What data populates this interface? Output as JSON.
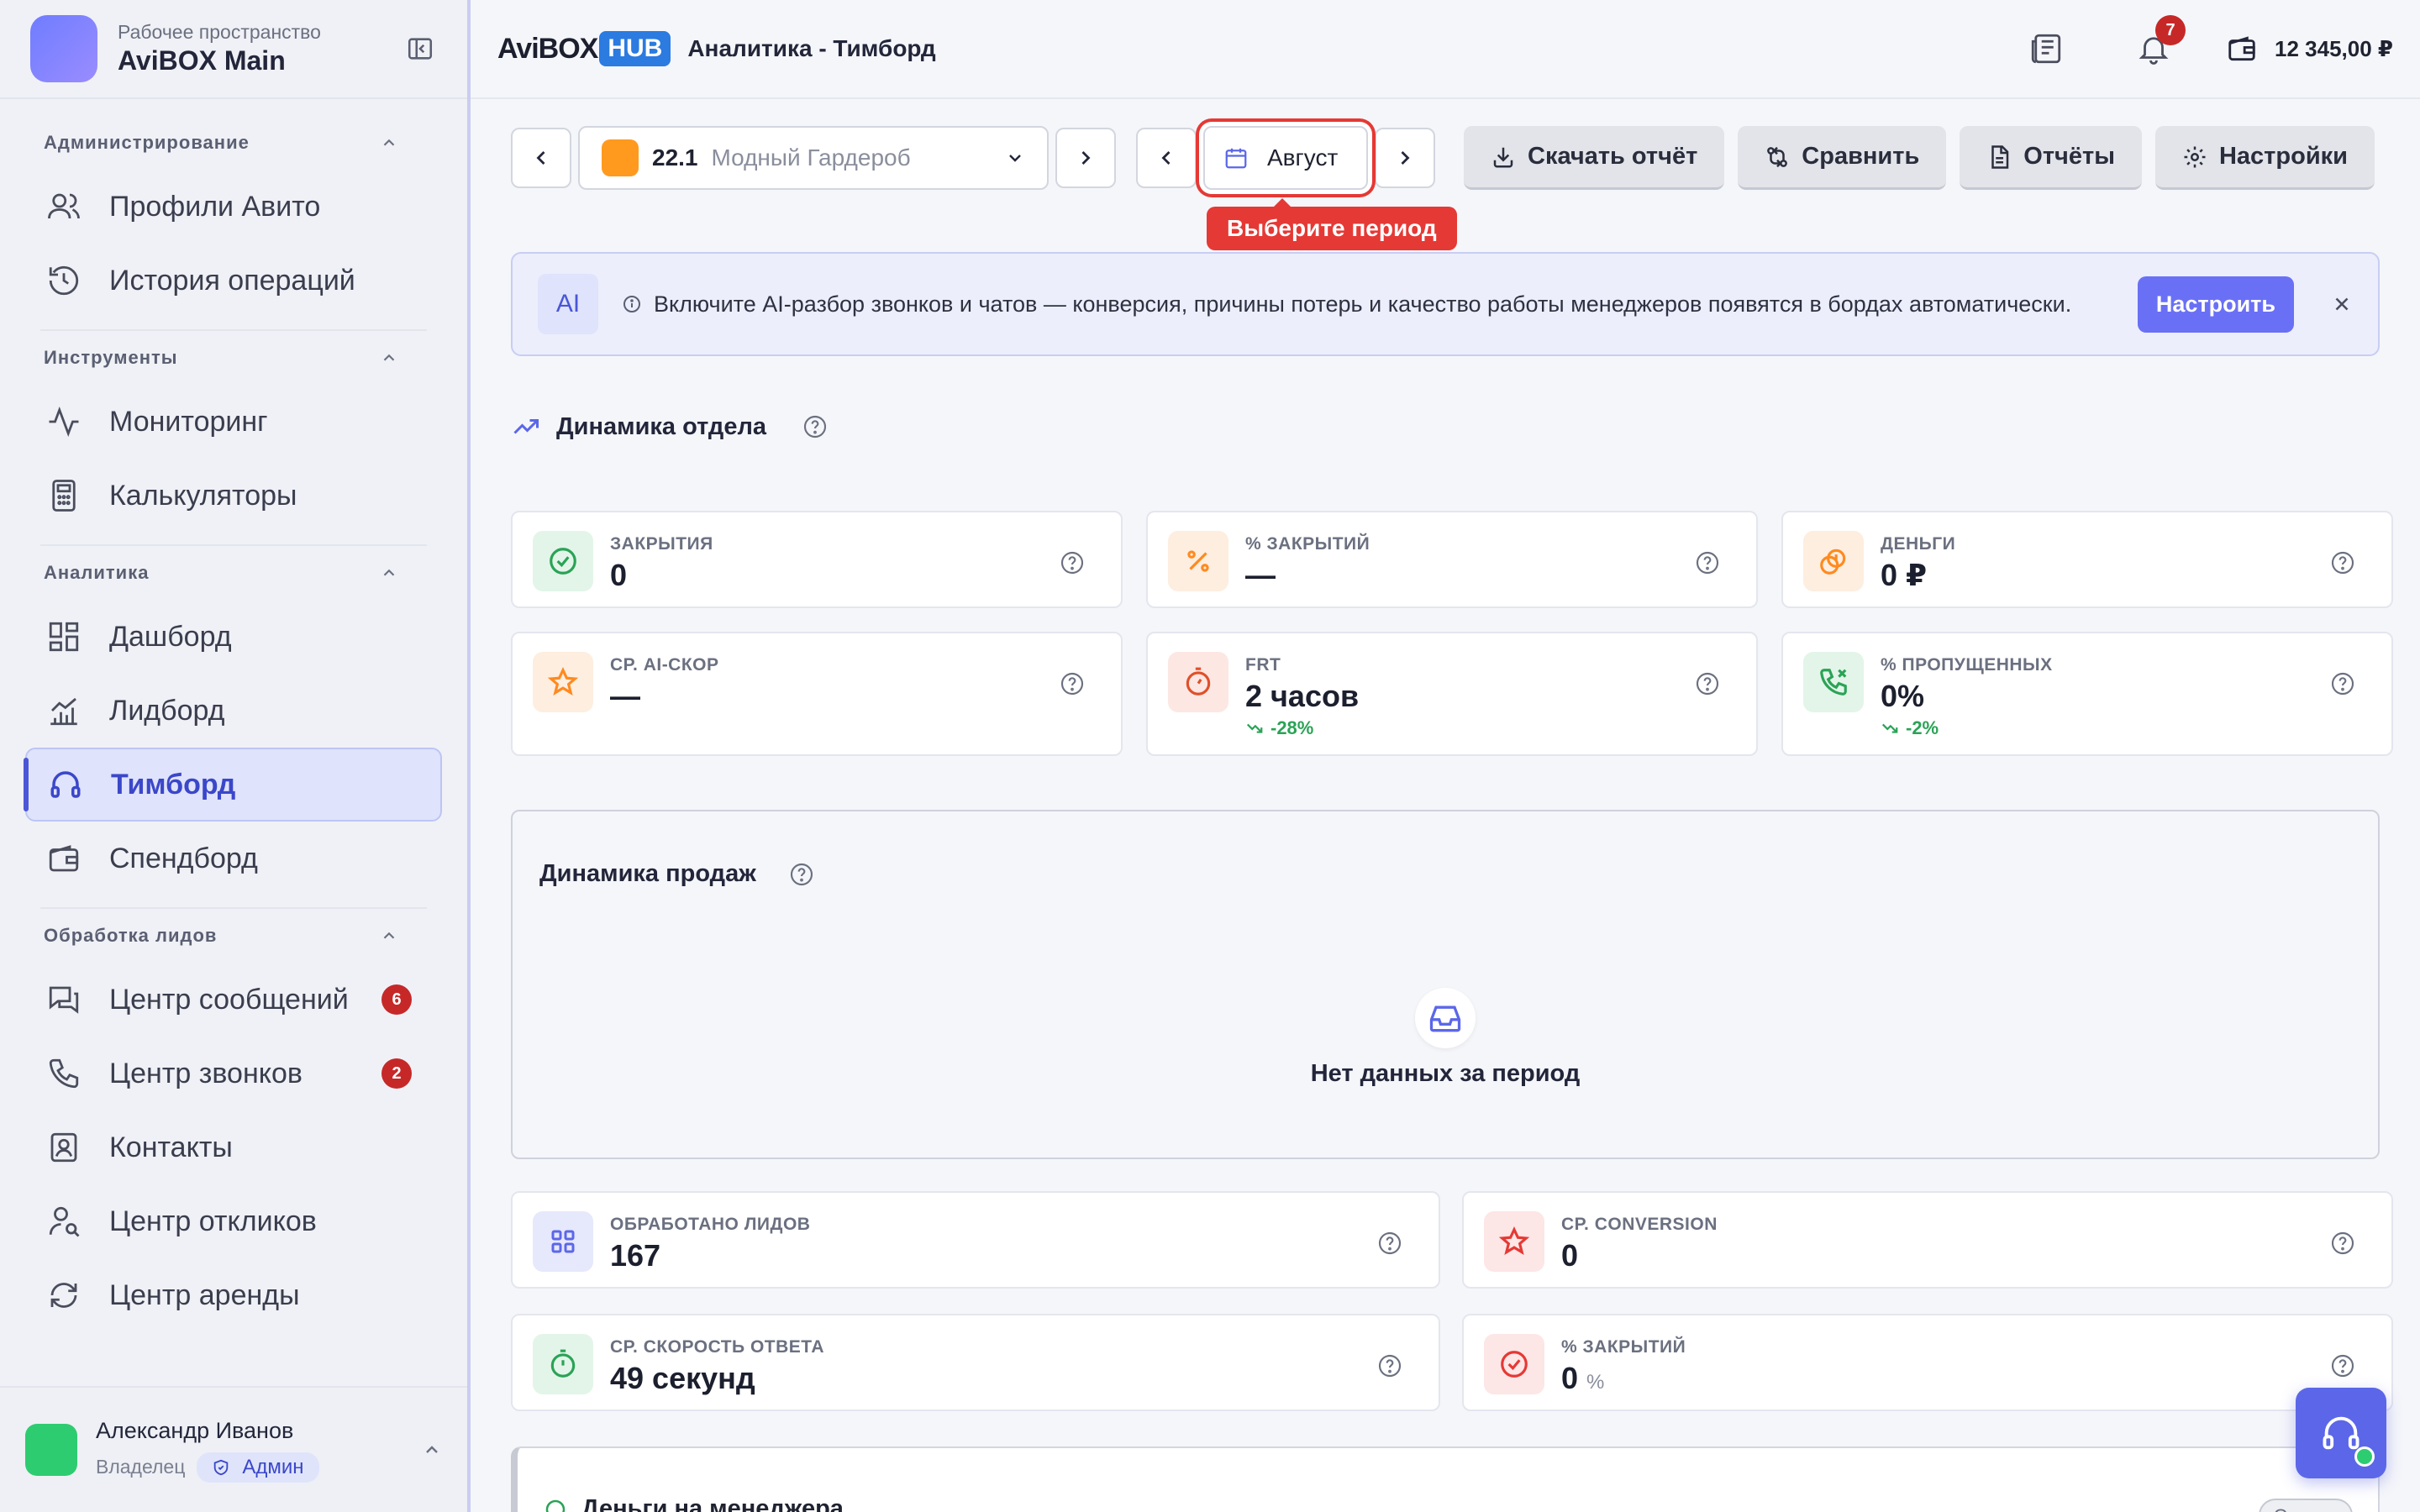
{
  "workspace": {
    "subtitle": "Рабочее пространство",
    "name": "AviBOX Main"
  },
  "sidebar": {
    "groups": [
      {
        "title": "Администрирование",
        "items": [
          {
            "label": "Профили Авито",
            "icon": "users-icon"
          },
          {
            "label": "История операций",
            "icon": "history-icon"
          }
        ]
      },
      {
        "title": "Инструменты",
        "items": [
          {
            "label": "Мониторинг",
            "icon": "activity-icon"
          },
          {
            "label": "Калькуляторы",
            "icon": "calculator-icon"
          }
        ]
      },
      {
        "title": "Аналитика",
        "items": [
          {
            "label": "Дашборд",
            "icon": "dashboard-icon"
          },
          {
            "label": "Лидборд",
            "icon": "chart-icon"
          },
          {
            "label": "Тимборд",
            "icon": "headset-icon",
            "active": true
          },
          {
            "label": "Спендборд",
            "icon": "wallet-icon"
          }
        ]
      },
      {
        "title": "Обработка лидов",
        "items": [
          {
            "label": "Центр сообщений",
            "icon": "messages-icon",
            "badge": "6"
          },
          {
            "label": "Центр звонков",
            "icon": "phone-icon",
            "badge": "2"
          },
          {
            "label": "Контакты",
            "icon": "contacts-icon"
          },
          {
            "label": "Центр откликов",
            "icon": "user-search-icon"
          },
          {
            "label": "Центр аренды",
            "icon": "refresh-icon"
          }
        ]
      }
    ]
  },
  "user": {
    "name": "Александр Иванов",
    "role": "Владелец",
    "badge": "Админ"
  },
  "header": {
    "brand_a": "AviBOX",
    "brand_b": "HUB",
    "title": "Аналитика - Тимборд",
    "notifications": "7",
    "balance": "12 345,00 ₽"
  },
  "toolbar": {
    "profile_num": "22.1",
    "profile_name": "Модный Гардероб",
    "period": "Август",
    "tooltip": "Выберите период",
    "download": "Скачать отчёт",
    "compare": "Сравнить",
    "reports": "Отчёты",
    "settings": "Настройки"
  },
  "ai_banner": {
    "badge": "AI",
    "text": "Включите AI-разбор звонков и чатов — конверсия, причины потерь и качество работы менеджеров появятся в бордах автоматически.",
    "button": "Настроить"
  },
  "dynamics": {
    "title": "Динамика отдела",
    "cards": [
      {
        "label": "ЗАКРЫТИЯ",
        "value": "0",
        "icon": "check-circle-icon",
        "color": "#2aa356"
      },
      {
        "label": "% ЗАКРЫТИЙ",
        "value": "—",
        "icon": "percent-icon",
        "color": "#ff8a1f"
      },
      {
        "label": "ДЕНЬГИ",
        "value": "0 ₽",
        "icon": "coins-icon",
        "color": "#ff8a1f"
      },
      {
        "label": "СР. AI-СКОР",
        "value": "—",
        "icon": "star-icon",
        "color": "#ff8a1f"
      },
      {
        "label": "FRT",
        "value": "2 часов",
        "delta": "-28%",
        "icon": "timer-icon",
        "color": "#e0502a"
      },
      {
        "label": "% ПРОПУЩЕННЫХ",
        "value": "0%",
        "delta": "-2%",
        "icon": "phone-missed-icon",
        "color": "#2aa356"
      }
    ]
  },
  "sales": {
    "title": "Динамика продаж",
    "empty": "Нет данных за период"
  },
  "stats": [
    {
      "label": "ОБРАБОТАНО ЛИДОВ",
      "value": "167",
      "icon": "grid-icon",
      "color": "#5b67e8"
    },
    {
      "label": "СР. CONVERSION",
      "value": "0",
      "icon": "star-icon",
      "color": "#e53935"
    },
    {
      "label": "СР. СКОРОСТЬ ОТВЕТА",
      "value": "49 секунд",
      "icon": "timer-icon",
      "color": "#2aa356"
    },
    {
      "label": "% ЗАКРЫТИЙ",
      "value": "0",
      "unit": "%",
      "icon": "check-circle-icon",
      "color": "#e53935"
    }
  ],
  "managers": {
    "title": "Деньги на менеджера",
    "pill": "Оценка"
  }
}
